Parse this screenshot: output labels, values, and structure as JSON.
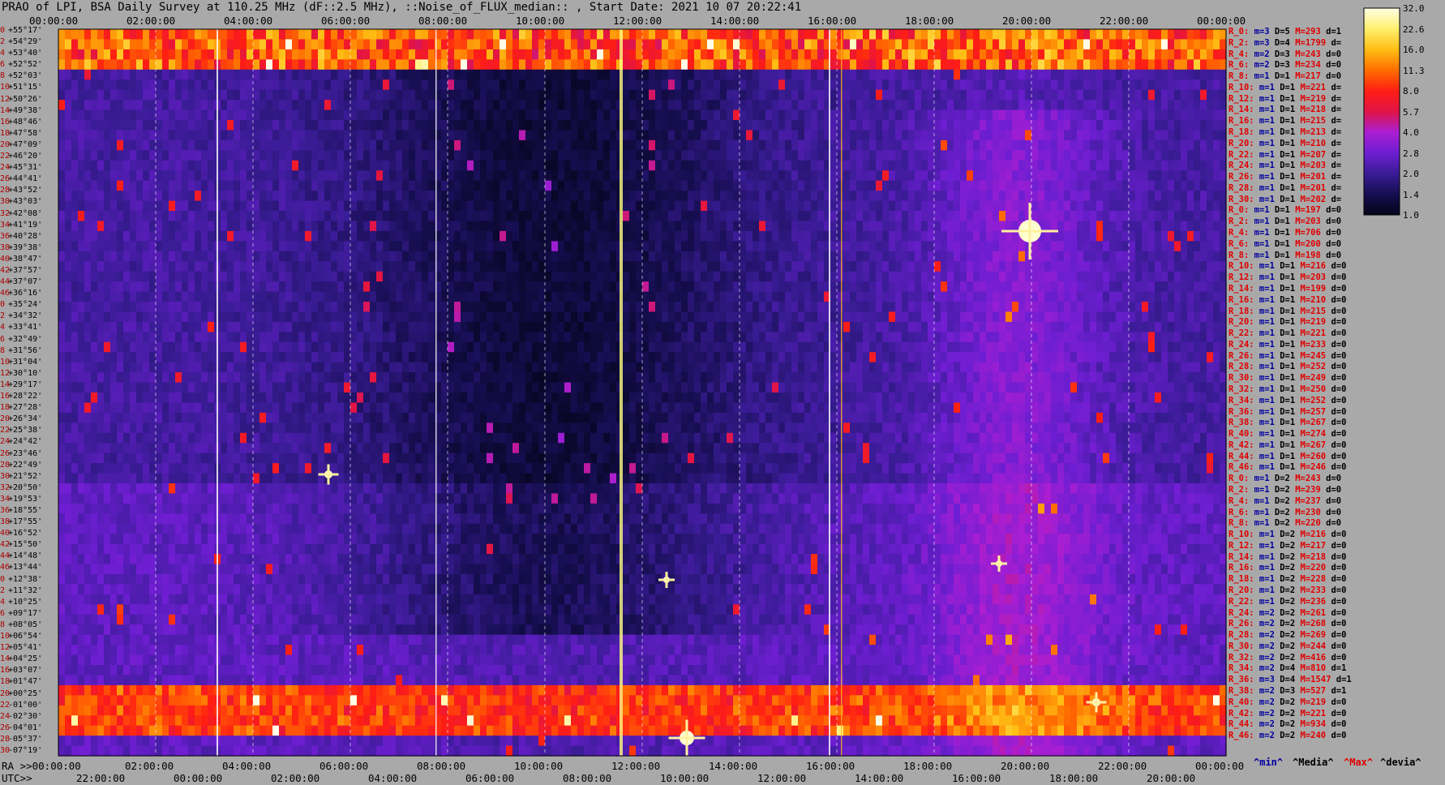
{
  "title": "PRAO of LPI, BSA Daily Survey at 110.25 MHz (dF::2.5 MHz), ::Noise_of_FLUX_median:: , Start Date: 2021 10 07 20:22:41",
  "colors": {
    "background": "#a9a9a9",
    "plot_dark": "#05041a",
    "plot_purple": "#4a1c9a",
    "hot": "#ff2020",
    "peak": "#ffffa0"
  },
  "chart_data": {
    "type": "heatmap",
    "title": "PRAO of LPI, BSA Daily Survey at 110.25 MHz (dF::2.5 MHz), ::Noise_of_FLUX_median:: , Start Date: 2021 10 07 20:22:41",
    "top_time_ticks": [
      "00:00:00",
      "02:00:00",
      "04:00:00",
      "06:00:00",
      "08:00:00",
      "10:00:00",
      "12:00:00",
      "14:00:00",
      "16:00:00",
      "18:00:00",
      "20:00:00",
      "22:00:00",
      "00:00:00"
    ],
    "ra_ticks": [
      "RA >>00:00:00",
      "02:00:00",
      "04:00:00",
      "06:00:00",
      "08:00:00",
      "10:00:00",
      "12:00:00",
      "14:00:00",
      "16:00:00",
      "18:00:00",
      "20:00:00",
      "22:00:00",
      "00:00:00"
    ],
    "utc_ticks": [
      "UTC>>",
      "22:00:00",
      "00:00:00",
      "02:00:00",
      "04:00:00",
      "06:00:00",
      "08:00:00",
      "10:00:00",
      "12:00:00",
      "14:00:00",
      "16:00:00",
      "18:00:00",
      "20:00:00"
    ],
    "dec_ticks": [
      "+55°17'",
      "+54°29'",
      "+53°40'",
      "+52°52'",
      "+52°03'",
      "+51°15'",
      "+50°26'",
      "+49°38'",
      "+48°46'",
      "+47°58'",
      "+47°09'",
      "+46°20'",
      "+45°31'",
      "+44°41'",
      "+43°52'",
      "+43°03'",
      "+42°08'",
      "+41°19'",
      "+40°28'",
      "+39°38'",
      "+38°47'",
      "+37°57'",
      "+37°07'",
      "+36°16'",
      "+35°24'",
      "+34°32'",
      "+33°41'",
      "+32°49'",
      "+31°56'",
      "+31°04'",
      "+30°10'",
      "+29°17'",
      "+28°22'",
      "+27°28'",
      "+26°34'",
      "+25°38'",
      "+24°42'",
      "+23°46'",
      "+22°49'",
      "+21°52'",
      "+20°50'",
      "+19°53'",
      "+18°55'",
      "+17°55'",
      "+16°52'",
      "+15°50'",
      "+14°48'",
      "+13°44'",
      "+12°38'",
      "+11°32'",
      "+10°25'",
      "+09°17'",
      "+08°05'",
      "+06°54'",
      "+05°41'",
      "+04°25'",
      "+03°07'",
      "+01°47'",
      "+00°25'",
      "-01°00'",
      "-02°30'",
      "-04°01'",
      "-05°37'",
      "-07°19'"
    ],
    "beam_index": [
      "0",
      "2",
      "4",
      "6",
      "8",
      "10",
      "12",
      "14",
      "16",
      "18",
      "20",
      "22",
      "24",
      "26",
      "28",
      "30",
      "32",
      "34",
      "36",
      "38",
      "40",
      "42",
      "44",
      "46",
      "0",
      "2",
      "4",
      "6",
      "8",
      "10",
      "12",
      "14",
      "16",
      "18",
      "20",
      "22",
      "24",
      "26",
      "28",
      "30",
      "32",
      "34",
      "36",
      "38",
      "40",
      "42",
      "44",
      "46",
      "0",
      "2",
      "4",
      "6",
      "8",
      "10",
      "12",
      "14",
      "16",
      "18",
      "20",
      "22",
      "24",
      "26",
      "28",
      "30",
      "32",
      "34",
      "36",
      "38",
      "40",
      "42",
      "44",
      "46"
    ],
    "colorbar_ticks": [
      "32.0",
      "22.6",
      "16.0",
      "11.3",
      "8.0",
      "5.7",
      "4.0",
      "2.8",
      "2.0",
      "1.4",
      "1.0"
    ],
    "stats": [
      [
        "R_0:",
        "3",
        "5",
        "293",
        "1"
      ],
      [
        "R_2:",
        "3",
        "4",
        "1799",
        ""
      ],
      [
        "R_4:",
        "2",
        "3",
        "243",
        "0"
      ],
      [
        "R_6:",
        "2",
        "3",
        "234",
        "0"
      ],
      [
        "R_8:",
        "1",
        "1",
        "217",
        "0"
      ],
      [
        "R_10:",
        "1",
        "1",
        "221",
        ""
      ],
      [
        "R_12:",
        "1",
        "1",
        "219",
        ""
      ],
      [
        "R_14:",
        "1",
        "1",
        "218",
        ""
      ],
      [
        "R_16:",
        "1",
        "1",
        "215",
        ""
      ],
      [
        "R_18:",
        "1",
        "1",
        "213",
        ""
      ],
      [
        "R_20:",
        "1",
        "1",
        "210",
        ""
      ],
      [
        "R_22:",
        "1",
        "1",
        "207",
        ""
      ],
      [
        "R_24:",
        "1",
        "1",
        "203",
        ""
      ],
      [
        "R_26:",
        "1",
        "1",
        "201",
        ""
      ],
      [
        "R_28:",
        "1",
        "1",
        "201",
        ""
      ],
      [
        "R_30:",
        "1",
        "1",
        "202",
        ""
      ],
      [
        "R_0:",
        "1",
        "1",
        "197",
        "0"
      ],
      [
        "R_2:",
        "1",
        "1",
        "203",
        "0"
      ],
      [
        "R_4:",
        "1",
        "1",
        "706",
        "0"
      ],
      [
        "R_6:",
        "1",
        "1",
        "200",
        "0"
      ],
      [
        "R_8:",
        "1",
        "1",
        "198",
        "0"
      ],
      [
        "R_10:",
        "1",
        "1",
        "216",
        "0"
      ],
      [
        "R_12:",
        "1",
        "1",
        "203",
        "0"
      ],
      [
        "R_14:",
        "1",
        "1",
        "199",
        "0"
      ],
      [
        "R_16:",
        "1",
        "1",
        "210",
        "0"
      ],
      [
        "R_18:",
        "1",
        "1",
        "215",
        "0"
      ],
      [
        "R_20:",
        "1",
        "1",
        "219",
        "0"
      ],
      [
        "R_22:",
        "1",
        "1",
        "221",
        "0"
      ],
      [
        "R_24:",
        "1",
        "1",
        "233",
        "0"
      ],
      [
        "R_26:",
        "1",
        "1",
        "245",
        "0"
      ],
      [
        "R_28:",
        "1",
        "1",
        "252",
        "0"
      ],
      [
        "R_30:",
        "1",
        "1",
        "249",
        "0"
      ],
      [
        "R_32:",
        "1",
        "1",
        "250",
        "0"
      ],
      [
        "R_34:",
        "1",
        "1",
        "252",
        "0"
      ],
      [
        "R_36:",
        "1",
        "1",
        "257",
        "0"
      ],
      [
        "R_38:",
        "1",
        "1",
        "267",
        "0"
      ],
      [
        "R_40:",
        "1",
        "1",
        "274",
        "0"
      ],
      [
        "R_42:",
        "1",
        "1",
        "267",
        "0"
      ],
      [
        "R_44:",
        "1",
        "1",
        "260",
        "0"
      ],
      [
        "R_46:",
        "1",
        "1",
        "246",
        "0"
      ],
      [
        "R_0:",
        "1",
        "2",
        "243",
        "0"
      ],
      [
        "R_2:",
        "1",
        "2",
        "239",
        "0"
      ],
      [
        "R_4:",
        "1",
        "2",
        "237",
        "0"
      ],
      [
        "R_6:",
        "1",
        "2",
        "230",
        "0"
      ],
      [
        "R_8:",
        "1",
        "2",
        "220",
        "0"
      ],
      [
        "R_10:",
        "1",
        "2",
        "216",
        "0"
      ],
      [
        "R_12:",
        "1",
        "2",
        "217",
        "0"
      ],
      [
        "R_14:",
        "1",
        "2",
        "218",
        "0"
      ],
      [
        "R_16:",
        "1",
        "2",
        "220",
        "0"
      ],
      [
        "R_18:",
        "1",
        "2",
        "228",
        "0"
      ],
      [
        "R_20:",
        "1",
        "2",
        "233",
        "0"
      ],
      [
        "R_22:",
        "1",
        "2",
        "236",
        "0"
      ],
      [
        "R_24:",
        "2",
        "2",
        "261",
        "0"
      ],
      [
        "R_26:",
        "2",
        "2",
        "268",
        "0"
      ],
      [
        "R_28:",
        "2",
        "2",
        "269",
        "0"
      ],
      [
        "R_30:",
        "2",
        "2",
        "244",
        "0"
      ],
      [
        "R_32:",
        "2",
        "2",
        "416",
        "0"
      ],
      [
        "R_34:",
        "2",
        "4",
        "810",
        "1"
      ],
      [
        "R_36:",
        "3",
        "4",
        "1547",
        "1"
      ],
      [
        "R_38:",
        "2",
        "3",
        "527",
        "1"
      ],
      [
        "R_40:",
        "2",
        "2",
        "219",
        "0"
      ],
      [
        "R_42:",
        "2",
        "2",
        "221",
        "0"
      ],
      [
        "R_44:",
        "2",
        "2",
        "934",
        "0"
      ],
      [
        "R_46:",
        "2",
        "2",
        "240",
        "0"
      ]
    ],
    "stats_labels": {
      "m": "m=",
      "D": "D=",
      "M": "M=",
      "d": "d="
    },
    "legend": {
      "min": "^min^",
      "median": "^Media^",
      "max": "^Max^",
      "dev": "^devia^"
    }
  }
}
